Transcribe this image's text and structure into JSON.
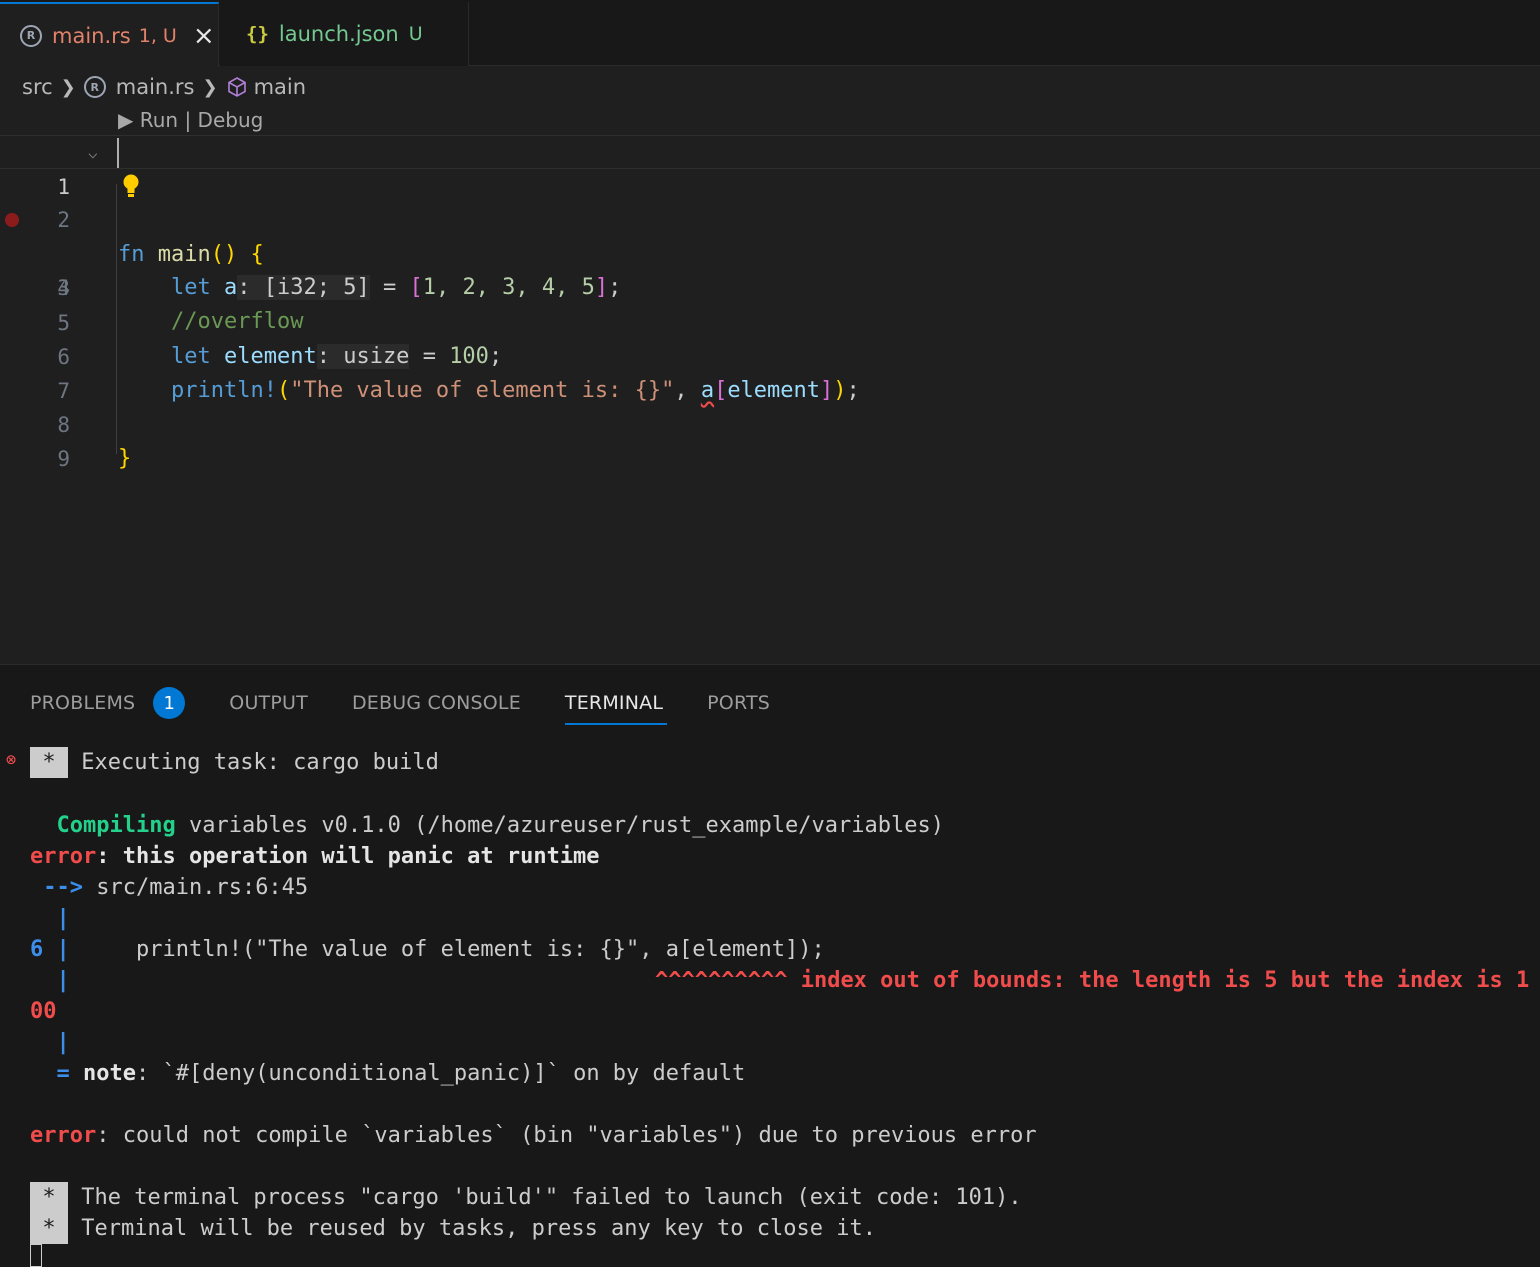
{
  "tabs": [
    {
      "name": "main.rs",
      "status": "1, U",
      "icon": "rust-icon",
      "active": true
    },
    {
      "name": "launch.json",
      "status": "U",
      "icon": "json-icon",
      "active": false
    }
  ],
  "breadcrumb": {
    "folder": "src",
    "file": "main.rs",
    "symbol": "main"
  },
  "codelens": "▶ Run | Debug",
  "editor": {
    "line_numbers": [
      "1",
      "2",
      "3",
      "4",
      "5",
      "6",
      "7",
      "8",
      "9"
    ],
    "lines": {
      "l1": {
        "kw": "fn",
        "fn": "main",
        "paren": "()",
        "brace": "{"
      },
      "l2": {
        "kw": "let",
        "var": "a",
        "type": "[i32; 5]",
        "eq": "=",
        "arr_open": "[",
        "items": "1, 2, 3, 4, 5",
        "arr_close": "]",
        "semi": ";"
      },
      "l4": {
        "comment": "//overflow"
      },
      "l5": {
        "kw": "let",
        "var": "element",
        "type": "usize",
        "eq": "=",
        "value": "100",
        "semi": ";"
      },
      "l6": {
        "macro": "println!",
        "open": "(",
        "string": "\"The value of element is: {}\"",
        "comma": ",",
        "arr": "a",
        "idx_open": "[",
        "idx": "element",
        "idx_close": "]",
        "close": ")",
        "semi": ";"
      },
      "l8": {
        "brace": "}"
      }
    }
  },
  "panel": {
    "tabs": [
      "PROBLEMS",
      "OUTPUT",
      "DEBUG CONSOLE",
      "TERMINAL",
      "PORTS"
    ],
    "problems_count": "1",
    "active_tab": "TERMINAL"
  },
  "terminal": {
    "task_star": "*",
    "task_line": "Executing task: cargo build",
    "compiling_word": "Compiling",
    "compiling_rest": "variables v0.1.0 (/home/azureuser/rust_example/variables)",
    "error_word": "error",
    "error_msg": ": this operation will panic at runtime",
    "arrow": "-->",
    "location": "src/main.rs:6:45",
    "pipe": "|",
    "src_line_no": "6",
    "src_line": "    println!(\"The value of element is: {}\", a[element]);",
    "carets": "^^^^^^^^^^",
    "bounds_msg": "index out of bounds: the length is 5 but the index is 1",
    "bounds_wrap": "00",
    "note_eq": "=",
    "note_word": "note",
    "note_msg": ": `#[deny(unconditional_panic)]` on by default",
    "error2_word": "error",
    "error2_msg": ": could not compile `variables` (bin \"variables\") due to previous error",
    "fail_line1": "The terminal process \"cargo 'build'\" failed to launch (exit code: 101).",
    "fail_line2": "Terminal will be reused by tasks, press any key to close it."
  },
  "colors": {
    "accent": "#0078d4",
    "error": "#f14c4c",
    "success": "#23d18b",
    "modified": "#e2826a",
    "untracked": "#73c991"
  }
}
